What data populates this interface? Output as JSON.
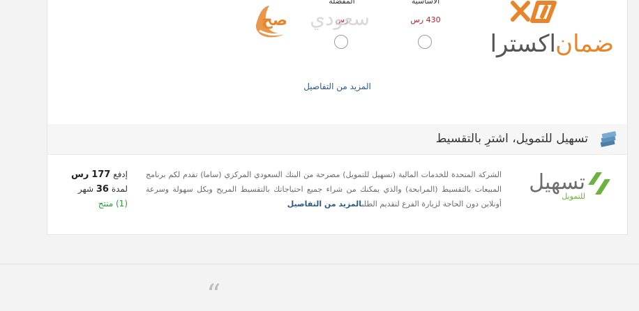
{
  "warranty": {
    "plans": [
      {
        "name": "الأساسية",
        "price": "430 رس"
      },
      {
        "name": "المفضلة",
        "price": "رس"
      }
    ],
    "more_details": "المزيد من التفاصيل"
  },
  "installment": {
    "header": "تسهيل للتمويل، اشترِ بالتقسيط",
    "description": "الشركة المتحدة للخدمات المالية (تسهيل للتمويل) مصرحة من البنك السعودي المركزي (ساما) تقدم لكم برنامج المبيعات بالتقسيط (المرابحة) والذي يمكنك من شراء جميع احتياجاتك بالتقسيط المريح وبكل سهولة وسرعة أونلاين دون الحاجة لزيارة الفرع لتقديم الطلب",
    "more_link": "المزيد من التفاصيل",
    "pay_prefix": "إدفع",
    "pay_amount": "177",
    "pay_currency": "رس",
    "duration_prefix": "لمدة",
    "duration_value": "36",
    "duration_unit": "شهر",
    "products_count": "(1) منتج"
  },
  "colors": {
    "accent": "#e8852b",
    "link": "#2a5a84",
    "price": "#b3232d",
    "green": "#2e9a3c"
  }
}
